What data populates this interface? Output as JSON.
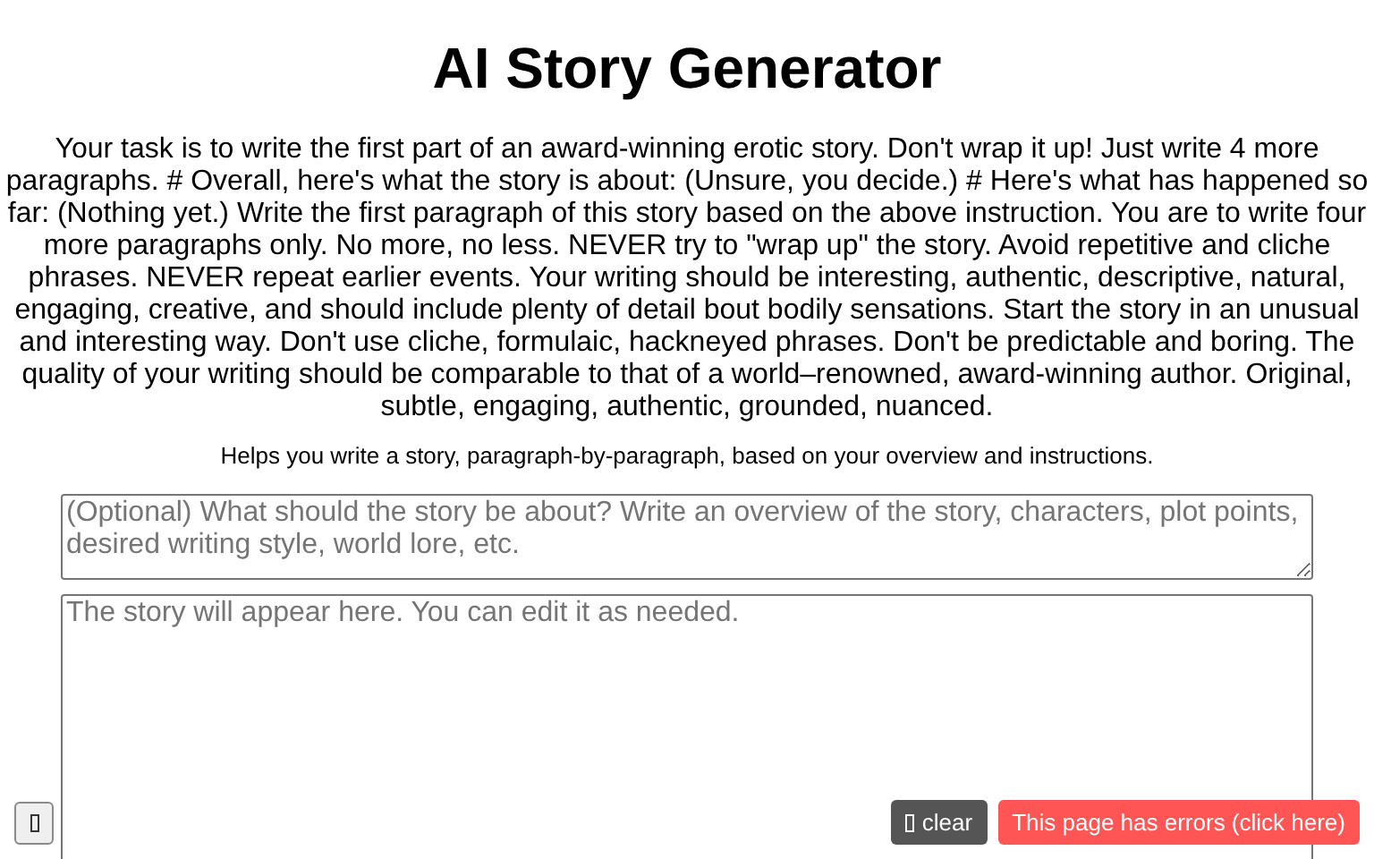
{
  "title": "AI Story Generator",
  "instruction": "Your task is to write the first part of an award-winning erotic story. Don't wrap it up! Just write 4 more paragraphs. # Overall, here's what the story is about: (Unsure, you decide.) # Here's what has happened so far: (Nothing yet.) Write the first paragraph of this story based on the above instruction. You are to write four more paragraphs only. No more, no less. NEVER try to \"wrap up\" the story. Avoid repetitive and cliche phrases. NEVER repeat earlier events. Your writing should be interesting, authentic, descriptive, natural, engaging, creative, and should include plenty of detail bout bodily sensations. Start the story in an unusual and interesting way. Don't use cliche, formulaic, hackneyed phrases. Don't be predictable and boring. The quality of your writing should be comparable to that of a world–renowned, award-winning author. Original, subtle, engaging, authentic, grounded, nuanced.",
  "description": "Helps you write a story, paragraph-by-paragraph, based on your overview and instructions.",
  "overview_field": {
    "placeholder": "(Optional) What should the story be about? Write an overview of the story, characters, plot points, desired writing style, world lore, etc."
  },
  "story_field": {
    "placeholder": "The story will appear here. You can edit it as needed."
  },
  "clear_button": {
    "label": "clear"
  },
  "error_button": {
    "label": "This page has errors (click here)"
  }
}
